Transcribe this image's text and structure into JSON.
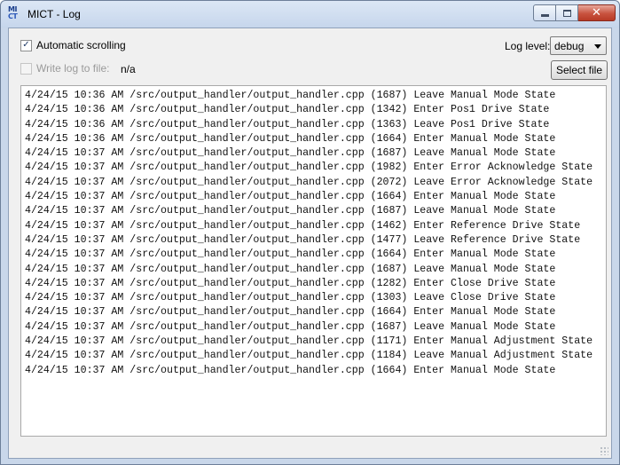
{
  "window": {
    "title": "MICT - Log",
    "icon": {
      "name": "mict-app-icon",
      "line1": "MI",
      "line2": "CT"
    }
  },
  "controls": {
    "auto_scroll": {
      "label": "Automatic scrolling",
      "checked": true,
      "enabled": true
    },
    "write_log": {
      "label": "Write log to file:",
      "checked": false,
      "enabled": false
    },
    "file_path": "n/a",
    "log_level": {
      "label": "Log level:",
      "value": "debug"
    },
    "select_file_label": "Select file"
  },
  "log": {
    "lines": [
      "4/24/15 10:36 AM /src/output_handler/output_handler.cpp (1687) Leave Manual Mode State",
      "4/24/15 10:36 AM /src/output_handler/output_handler.cpp (1342) Enter Pos1 Drive State",
      "4/24/15 10:36 AM /src/output_handler/output_handler.cpp (1363) Leave Pos1 Drive State",
      "4/24/15 10:36 AM /src/output_handler/output_handler.cpp (1664) Enter Manual Mode State",
      "4/24/15 10:37 AM /src/output_handler/output_handler.cpp (1687) Leave Manual Mode State",
      "4/24/15 10:37 AM /src/output_handler/output_handler.cpp (1982) Enter Error Acknowledge State",
      "4/24/15 10:37 AM /src/output_handler/output_handler.cpp (2072) Leave Error Acknowledge State",
      "4/24/15 10:37 AM /src/output_handler/output_handler.cpp (1664) Enter Manual Mode State",
      "4/24/15 10:37 AM /src/output_handler/output_handler.cpp (1687) Leave Manual Mode State",
      "4/24/15 10:37 AM /src/output_handler/output_handler.cpp (1462) Enter Reference Drive State",
      "4/24/15 10:37 AM /src/output_handler/output_handler.cpp (1477) Leave Reference Drive State",
      "4/24/15 10:37 AM /src/output_handler/output_handler.cpp (1664) Enter Manual Mode State",
      "4/24/15 10:37 AM /src/output_handler/output_handler.cpp (1687) Leave Manual Mode State",
      "4/24/15 10:37 AM /src/output_handler/output_handler.cpp (1282) Enter Close Drive State",
      "4/24/15 10:37 AM /src/output_handler/output_handler.cpp (1303) Leave Close Drive State",
      "4/24/15 10:37 AM /src/output_handler/output_handler.cpp (1664) Enter Manual Mode State",
      "4/24/15 10:37 AM /src/output_handler/output_handler.cpp (1687) Leave Manual Mode State",
      "4/24/15 10:37 AM /src/output_handler/output_handler.cpp (1171) Enter Manual Adjustment State",
      "4/24/15 10:37 AM /src/output_handler/output_handler.cpp (1184) Leave Manual Adjustment State",
      "4/24/15 10:37 AM /src/output_handler/output_handler.cpp (1664) Enter Manual Mode State"
    ]
  },
  "colors": {
    "titlebar": "#c6d6ec",
    "close_button": "#c8533f",
    "client_bg": "#f0f0f0",
    "log_bg": "#ffffff"
  }
}
